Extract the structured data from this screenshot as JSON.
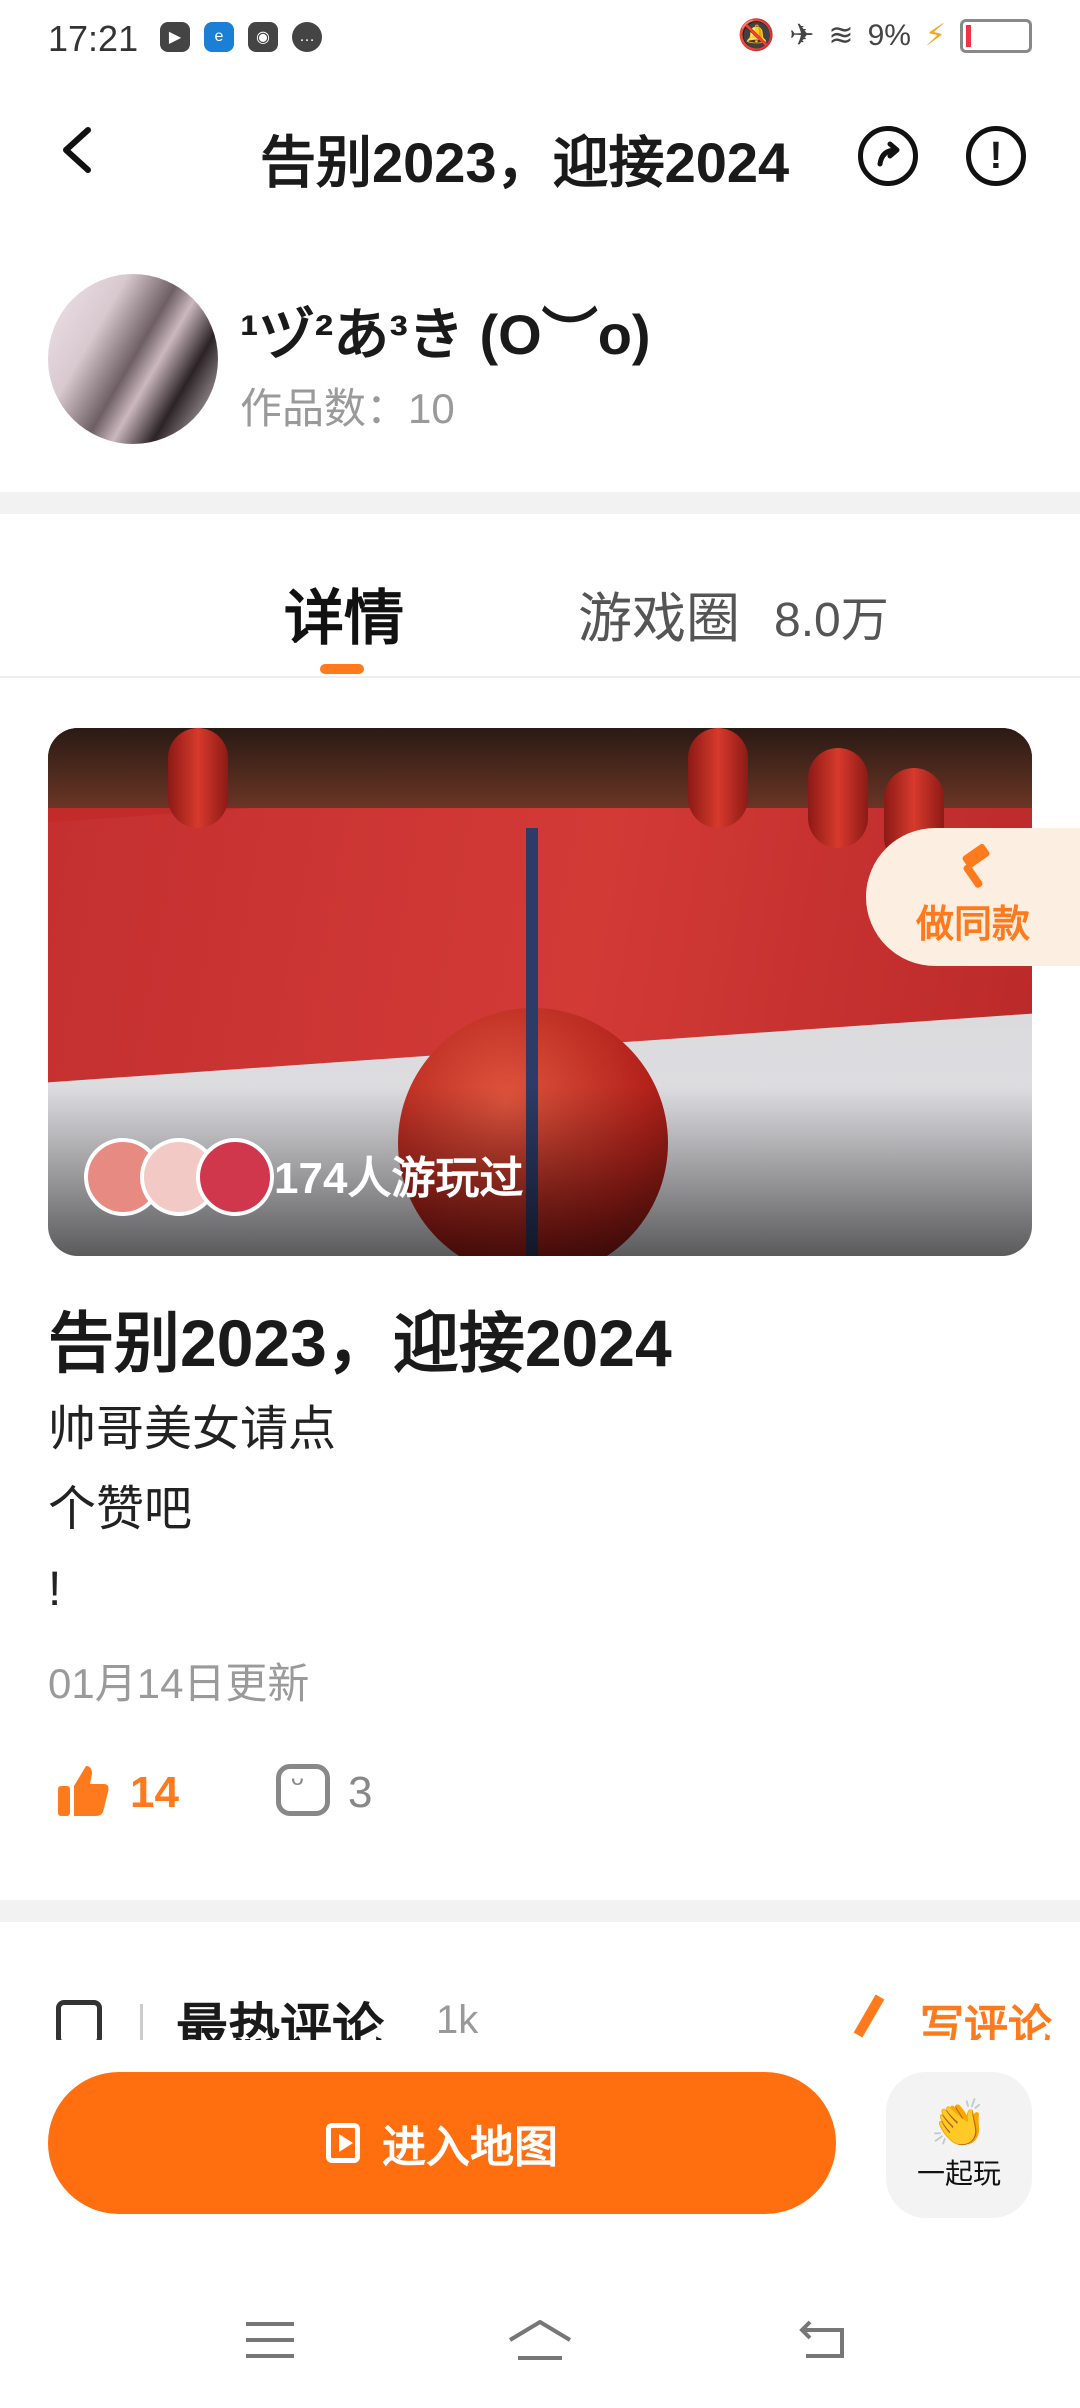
{
  "status_bar": {
    "time": "17:21",
    "battery": "9%",
    "icons": [
      "video-app-icon",
      "browser-app-icon",
      "game-app-icon",
      "message-icon",
      "mute-icon",
      "airplane-icon",
      "wifi-icon",
      "charging-icon"
    ]
  },
  "header": {
    "title": "告别2023，迎接2024",
    "icons": [
      "back-icon",
      "share-icon",
      "report-icon"
    ]
  },
  "author": {
    "name": "¹ヅ²あ³き (O︶o)",
    "works": "作品数：10"
  },
  "tabs": {
    "detail": "详情",
    "circle": "游戏圈",
    "circle_count": "8.0万"
  },
  "cover": {
    "players_text": "174人游玩过"
  },
  "same_style": {
    "label": "做同款"
  },
  "map": {
    "title": "告别2023，迎接2024",
    "description": "帅哥美女请点\n个赞吧\n!",
    "updated": "01月14日更新",
    "likes": "14",
    "comments": "3"
  },
  "comments": {
    "title": "最热评论",
    "count": "1k",
    "write": "写评论"
  },
  "bottom": {
    "enter": "进入地图",
    "together": "一起玩"
  },
  "colors": {
    "accent": "#ff7a1c",
    "button": "#ff6f0f"
  }
}
